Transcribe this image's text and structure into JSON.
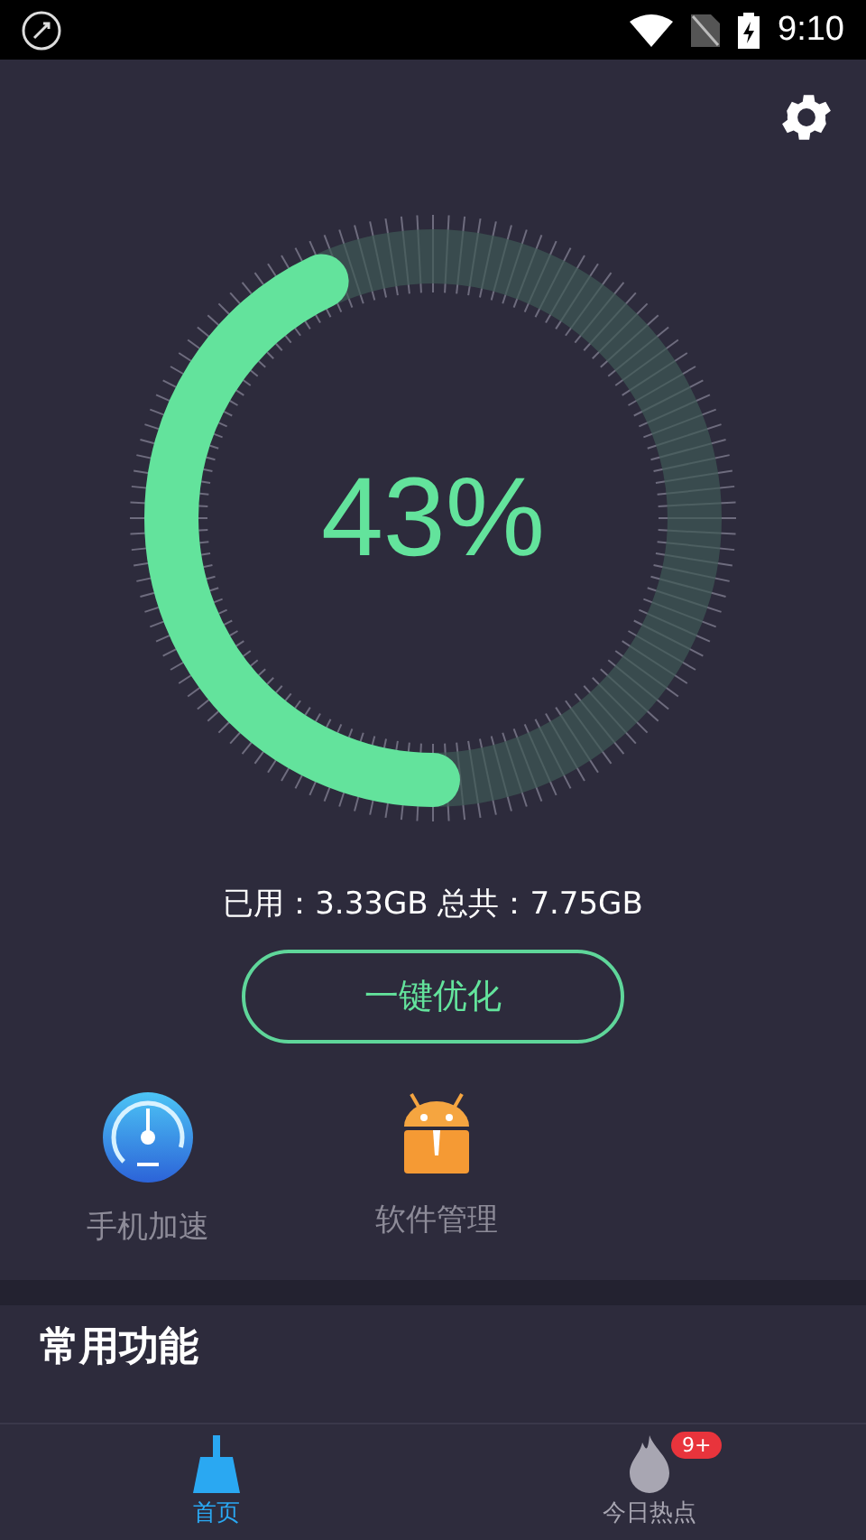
{
  "status_bar": {
    "time": "9:10"
  },
  "gauge": {
    "level": 0.43,
    "reading": "43%"
  },
  "memory": {
    "text": "已用：3.33GB 总共：7.75GB"
  },
  "optimize_button": {
    "label": "一键优化"
  },
  "features": [
    {
      "kind": "speed",
      "label": "手机加速"
    },
    {
      "kind": "apps",
      "label": "软件管理"
    }
  ],
  "section": {
    "title": "常用功能"
  },
  "tab_bar": [
    {
      "kind": "clean",
      "label": "首页",
      "selected": true
    },
    {
      "kind": "hot",
      "label": "今日热点",
      "selected": false,
      "badge": "9+"
    }
  ]
}
